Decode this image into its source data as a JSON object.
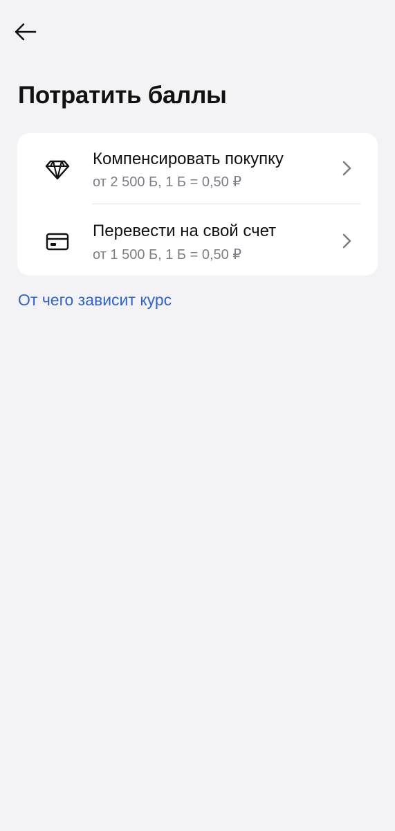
{
  "header": {
    "back_icon": "arrow-left-icon",
    "title": "Потратить баллы"
  },
  "options": [
    {
      "icon": "diamond-icon",
      "title": "Компенсировать покупку",
      "subtitle": "от 2 500 Б, 1 Б = 0,50 ₽",
      "chevron_icon": "chevron-right-icon"
    },
    {
      "icon": "card-icon",
      "title": "Перевести на свой счет",
      "subtitle": "от 1 500 Б, 1 Б = 0,50 ₽",
      "chevron_icon": "chevron-right-icon"
    }
  ],
  "footer_link": {
    "label": "От чего зависит курс"
  },
  "colors": {
    "background": "#f3f3f5",
    "card": "#ffffff",
    "text_primary": "#111111",
    "text_secondary": "#7b7d84",
    "link": "#2f63c6",
    "divider": "#dcdde1"
  }
}
